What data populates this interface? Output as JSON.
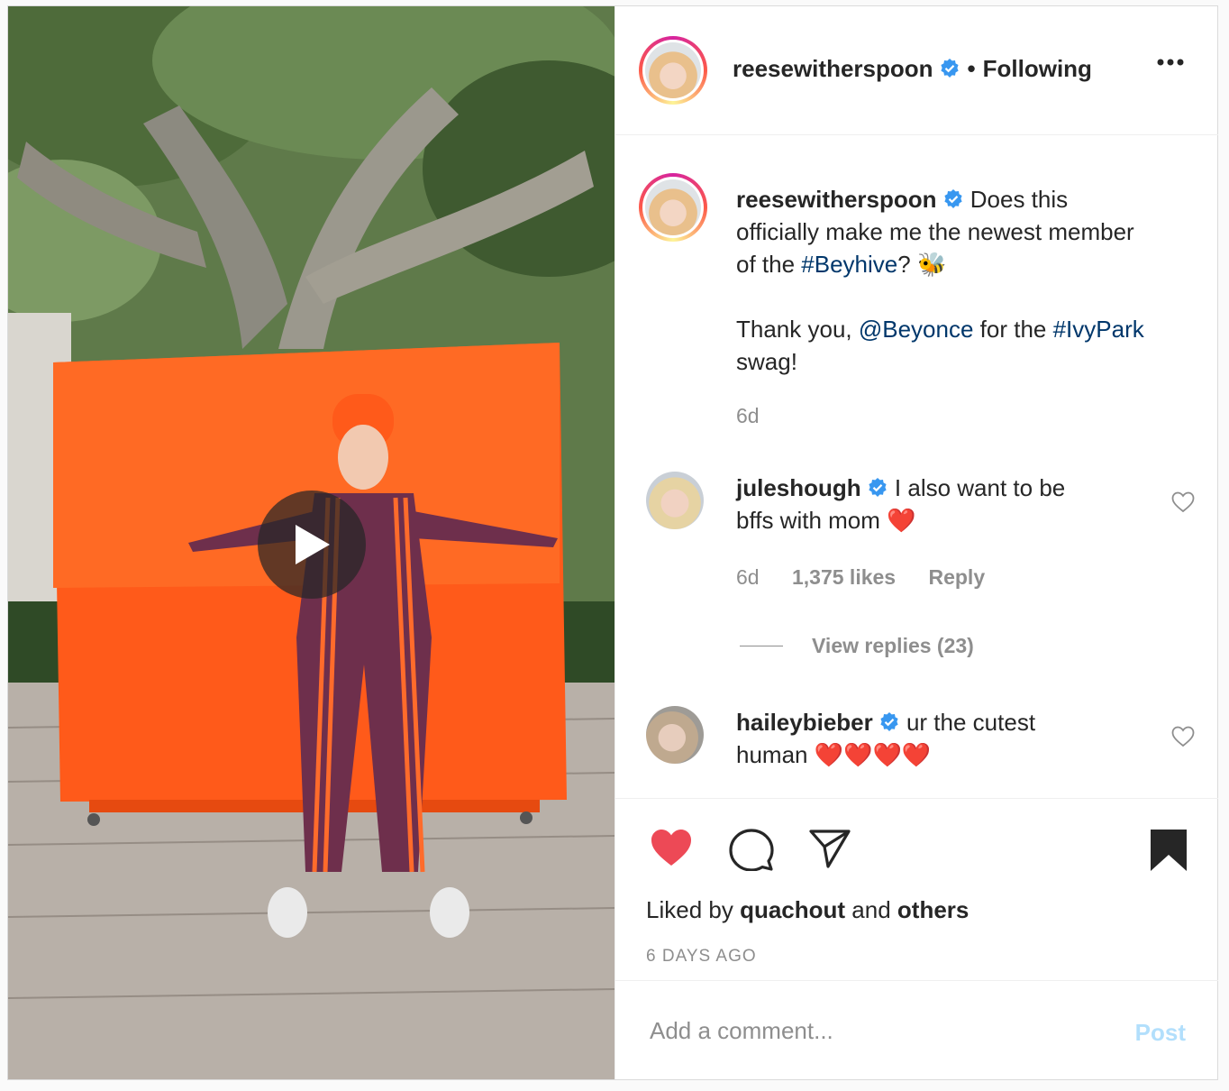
{
  "author": {
    "username": "reesewitherspoon",
    "dot": "•",
    "follow_status": "Following"
  },
  "caption": {
    "username": "reesewitherspoon",
    "line1": "Does this",
    "line2": "officially make me the newest member",
    "line3_prefix": "of the ",
    "hashtag_beyhive": "#Beyhive",
    "line3_suffix": "? ",
    "bee_emoji": "🐝",
    "line4_prefix": "Thank you, ",
    "mention_beyonce": "@Beyonce",
    "line4_mid": " for the ",
    "hashtag_ivypark": "#IvyPark",
    "line5": "swag!",
    "age": "6d"
  },
  "comments": [
    {
      "username": "juleshough",
      "text_line1": "I also want to be",
      "text_line2": "bffs with mom ",
      "emoji": "❤️",
      "age": "6d",
      "likes": "1,375 likes",
      "reply": "Reply",
      "view_replies": "View replies (23)"
    },
    {
      "username": "haileybieber",
      "text_line1": "ur the cutest",
      "text_line2": "human ",
      "emoji": "❤️❤️❤️❤️"
    }
  ],
  "likes": {
    "prefix": "Liked by ",
    "user": "quachout",
    "and": " and ",
    "others": "others"
  },
  "timestamp": "6 DAYS AGO",
  "add_comment": {
    "placeholder": "Add a comment...",
    "post_label": "Post"
  },
  "colors": {
    "verified": "#3897f0",
    "like_red": "#ed4956",
    "link": "#00376b",
    "post_disabled": "#b2dffc"
  },
  "icons": {
    "like": "heart-filled-icon",
    "comment": "speech-bubble-icon",
    "share": "paper-plane-icon",
    "save": "bookmark-filled-icon",
    "more": "ellipsis-icon",
    "play": "play-icon"
  }
}
